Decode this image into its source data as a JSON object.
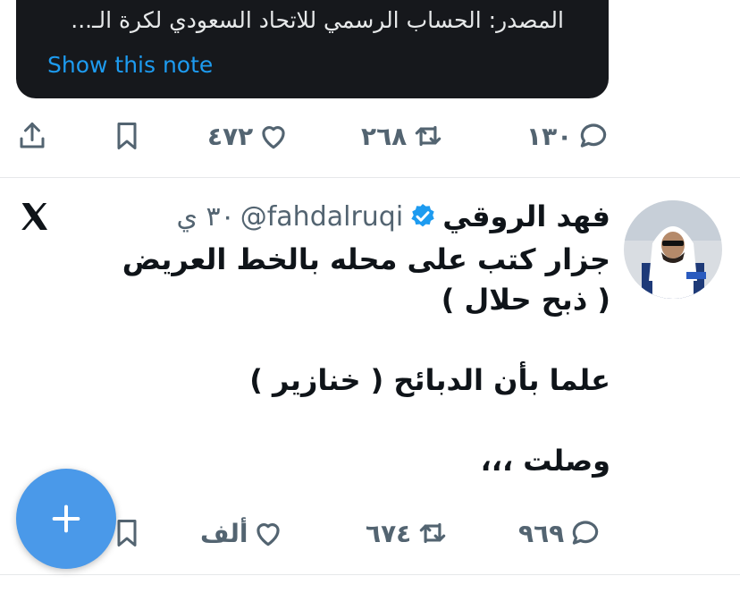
{
  "note": {
    "text": "المصدر: الحساب الرسمي للاتحاد السعودي لكرة الـ...",
    "link": "Show this note"
  },
  "tweet1_actions": {
    "replies": "١٣٠",
    "reposts": "٢٦٨",
    "likes": "٤٧٢"
  },
  "tweet2": {
    "author_name": "فهد الروقي",
    "verified": true,
    "handle": "@fahdalruqi",
    "time": "٣٠ ي",
    "body_lines": [
      "جزار كتب على محله بالخط العريض",
      "( ذبح حلال )",
      "",
      "علما بأن الدبائح ( خنازير )",
      "",
      "وصلت ،،،"
    ],
    "actions": {
      "replies": "٩٦٩",
      "reposts": "٦٧٤",
      "likes": "ألف"
    }
  },
  "compose_button": {
    "icon": "plus-icon"
  },
  "colors": {
    "accent": "#1d9bf0",
    "fab": "#4a99e9",
    "note_bg": "#16181c",
    "muted": "#536471"
  }
}
